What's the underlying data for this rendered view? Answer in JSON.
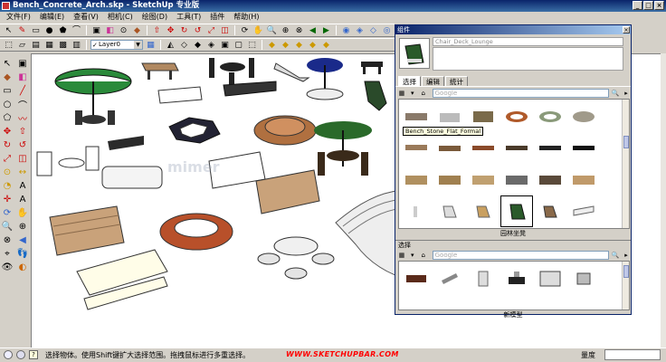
{
  "window": {
    "title": "Bench_Concrete_Arch.skp - SketchUp 专业版",
    "min": "_",
    "max": "□",
    "close": "×"
  },
  "menu": [
    "文件(F)",
    "编辑(E)",
    "查看(V)",
    "相机(C)",
    "绘图(D)",
    "工具(T)",
    "插件",
    "帮助(H)"
  ],
  "layer": {
    "name": "Layer0"
  },
  "components": {
    "title": "组件",
    "name_placeholder": "Chair_Deck_Lounge",
    "tabs": [
      "选择",
      "编辑",
      "统计"
    ],
    "search_placeholder": "Google",
    "tooltip": "Bench_Stone_Flat_Formal",
    "grid_caption": "园林坐凳",
    "section2_label": "选择",
    "search2_placeholder": "Google",
    "grid2_caption": "新模型"
  },
  "status": {
    "hint": "选择物体。使用Shift键扩大选择范围。拖拽鼠标进行多重选择。",
    "brand": "WWW.SKETCHUPBAR.COM",
    "measure_label": "量度"
  },
  "watermark": "mimer",
  "colors": {
    "titlebar": "#0a246a",
    "brand": "#ff0000",
    "selection": "#000000"
  }
}
